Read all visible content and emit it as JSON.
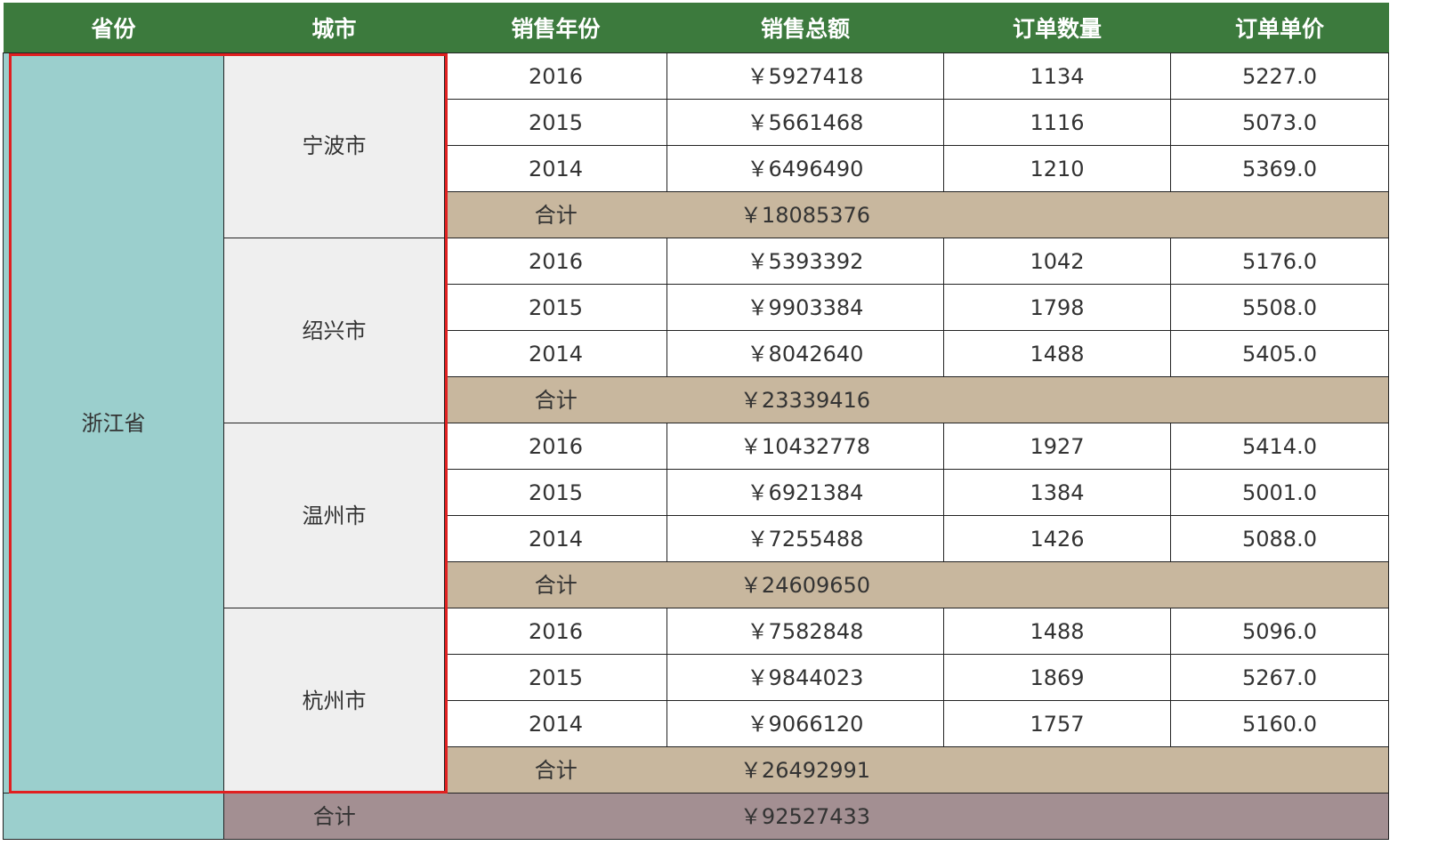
{
  "header": {
    "province": "省份",
    "city": "城市",
    "year": "销售年份",
    "total": "销售总额",
    "orders": "订单数量",
    "unit_price": "订单单价"
  },
  "province": "浙江省",
  "cities": [
    {
      "name": "宁波市",
      "rows": [
        {
          "year": "2016",
          "total": "￥5927418",
          "orders": "1134",
          "price": "5227.0"
        },
        {
          "year": "2015",
          "total": "￥5661468",
          "orders": "1116",
          "price": "5073.0"
        },
        {
          "year": "2014",
          "total": "￥6496490",
          "orders": "1210",
          "price": "5369.0"
        }
      ],
      "subtotal_label": "合计",
      "subtotal": "￥18085376"
    },
    {
      "name": "绍兴市",
      "rows": [
        {
          "year": "2016",
          "total": "￥5393392",
          "orders": "1042",
          "price": "5176.0"
        },
        {
          "year": "2015",
          "total": "￥9903384",
          "orders": "1798",
          "price": "5508.0"
        },
        {
          "year": "2014",
          "total": "￥8042640",
          "orders": "1488",
          "price": "5405.0"
        }
      ],
      "subtotal_label": "合计",
      "subtotal": "￥23339416"
    },
    {
      "name": "温州市",
      "rows": [
        {
          "year": "2016",
          "total": "￥10432778",
          "orders": "1927",
          "price": "5414.0"
        },
        {
          "year": "2015",
          "total": "￥6921384",
          "orders": "1384",
          "price": "5001.0"
        },
        {
          "year": "2014",
          "total": "￥7255488",
          "orders": "1426",
          "price": "5088.0"
        }
      ],
      "subtotal_label": "合计",
      "subtotal": "￥24609650"
    },
    {
      "name": "杭州市",
      "rows": [
        {
          "year": "2016",
          "total": "￥7582848",
          "orders": "1488",
          "price": "5096.0"
        },
        {
          "year": "2015",
          "total": "￥9844023",
          "orders": "1869",
          "price": "5267.0"
        },
        {
          "year": "2014",
          "total": "￥9066120",
          "orders": "1757",
          "price": "5160.0"
        }
      ],
      "subtotal_label": "合计",
      "subtotal": "￥26492991"
    }
  ],
  "grand_total_label": "合计",
  "grand_total": "￥92527433",
  "colors": {
    "header_bg": "#3c7a3d",
    "province_bg": "#9bcfcd",
    "city_bg": "#efefef",
    "subtotal_bg": "#c8b79e",
    "grand_total_bg": "#a38f92",
    "highlight_border": "#e02020"
  }
}
